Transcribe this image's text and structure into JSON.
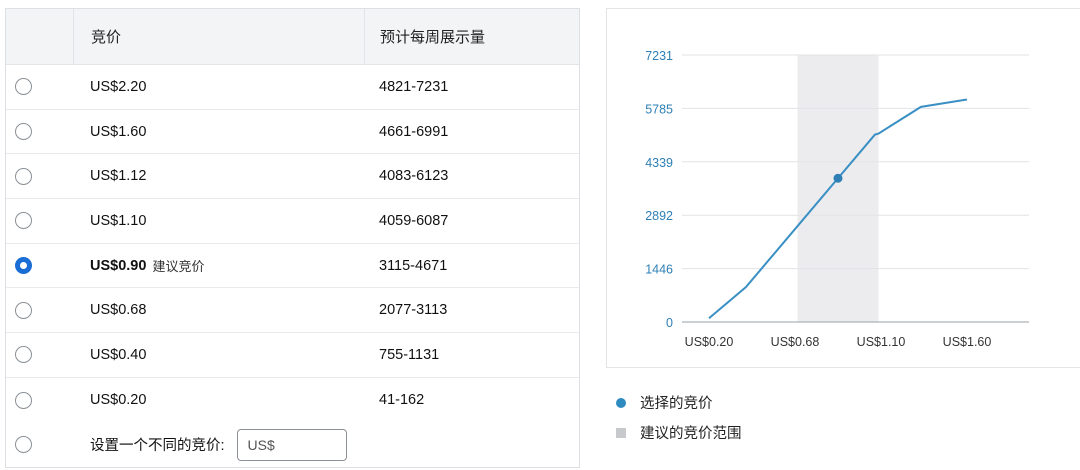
{
  "table": {
    "header": {
      "bid": "竞价",
      "impressions": "预计每周展示量"
    },
    "rows": [
      {
        "bid": "US$2.20",
        "impressions": "4821-7231",
        "selected": false,
        "tag": ""
      },
      {
        "bid": "US$1.60",
        "impressions": "4661-6991",
        "selected": false,
        "tag": ""
      },
      {
        "bid": "US$1.12",
        "impressions": "4083-6123",
        "selected": false,
        "tag": ""
      },
      {
        "bid": "US$1.10",
        "impressions": "4059-6087",
        "selected": false,
        "tag": ""
      },
      {
        "bid": "US$0.90",
        "impressions": "3115-4671",
        "selected": true,
        "tag": "建议竞价"
      },
      {
        "bid": "US$0.68",
        "impressions": "2077-3113",
        "selected": false,
        "tag": ""
      },
      {
        "bid": "US$0.40",
        "impressions": "755-1131",
        "selected": false,
        "tag": ""
      },
      {
        "bid": "US$0.20",
        "impressions": "41-162",
        "selected": false,
        "tag": ""
      }
    ],
    "custom": {
      "label": "设置一个不同的竞价:",
      "placeholder": "US$"
    }
  },
  "legend": {
    "selected": "选择的竞价",
    "range": "建议的竞价范围"
  },
  "colors": {
    "accent": "#1a6dd4",
    "line": "#3a8fc4",
    "axis_text": "#2e7fb5",
    "band": "#ececee"
  },
  "chart_data": {
    "type": "line",
    "x_ticks": [
      "US$0.20",
      "US$0.68",
      "US$1.10",
      "US$1.60"
    ],
    "y_ticks": [
      0,
      1446,
      2892,
      4339,
      5785,
      7231
    ],
    "ylim": [
      0,
      7231
    ],
    "x": [
      0.2,
      0.4,
      0.68,
      0.9,
      1.1,
      1.12,
      1.35,
      1.6
    ],
    "y": [
      101,
      943,
      2595,
      3893,
      5073,
      5103,
      5826,
      6026
    ],
    "highlight_band": [
      0.68,
      1.12
    ],
    "selected_point": {
      "x": 0.9,
      "y": 3893
    },
    "grid": true
  }
}
